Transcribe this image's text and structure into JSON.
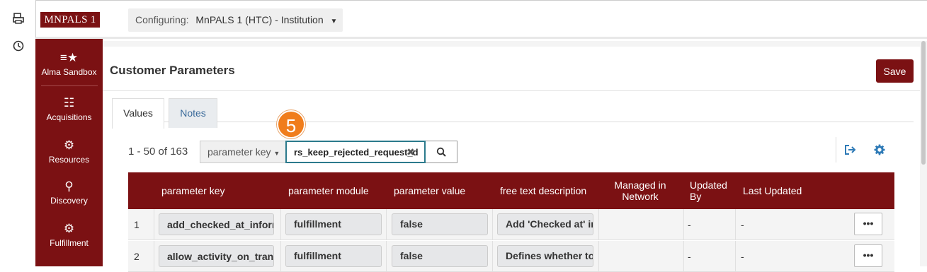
{
  "rail": {
    "icons": [
      "printer-icon",
      "history-clock-icon"
    ]
  },
  "header": {
    "logo": "MNPALS 1",
    "configuring_label": "Configuring:",
    "configuring_value": "MnPALS 1 (HTC) - Institution"
  },
  "sidebar": {
    "items": [
      {
        "label": "Alma Sandbox",
        "icon": "list-star-icon"
      },
      {
        "label": "Acquisitions",
        "icon": "acquisitions-gear-icon"
      },
      {
        "label": "Resources",
        "icon": "resources-gear-icon"
      },
      {
        "label": "Discovery",
        "icon": "telescope-gear-icon"
      },
      {
        "label": "Fulfillment",
        "icon": "fulfillment-gear-icon"
      }
    ]
  },
  "page": {
    "title": "Customer Parameters",
    "save_label": "Save"
  },
  "tabs": [
    {
      "label": "Values",
      "active": true
    },
    {
      "label": "Notes",
      "active": false
    }
  ],
  "filter": {
    "count": "1 - 50 of 163",
    "key_label": "parameter key",
    "search_value": "rs_keep_rejected_request_d",
    "step_badge": "5"
  },
  "table": {
    "headers": [
      "parameter key",
      "parameter module",
      "parameter value",
      "free text description",
      "Managed in Network",
      "Updated By",
      "Last Updated"
    ],
    "rows": [
      {
        "num": "1",
        "key": "add_checked_at_inform",
        "module": "fulfillment",
        "value": "false",
        "description": "Add 'Checked at' in",
        "managed": "",
        "updated_by": "-",
        "last_updated": "-",
        "actions": "•••"
      },
      {
        "num": "2",
        "key": "allow_activity_on_trans",
        "module": "fulfillment",
        "value": "false",
        "description": "Defines whether to",
        "managed": "",
        "updated_by": "-",
        "last_updated": "-",
        "actions": "•••"
      }
    ]
  },
  "colors": {
    "brand": "#7b1113",
    "accent_blue": "#2f7bb7",
    "badge_orange": "#f07d1c"
  }
}
